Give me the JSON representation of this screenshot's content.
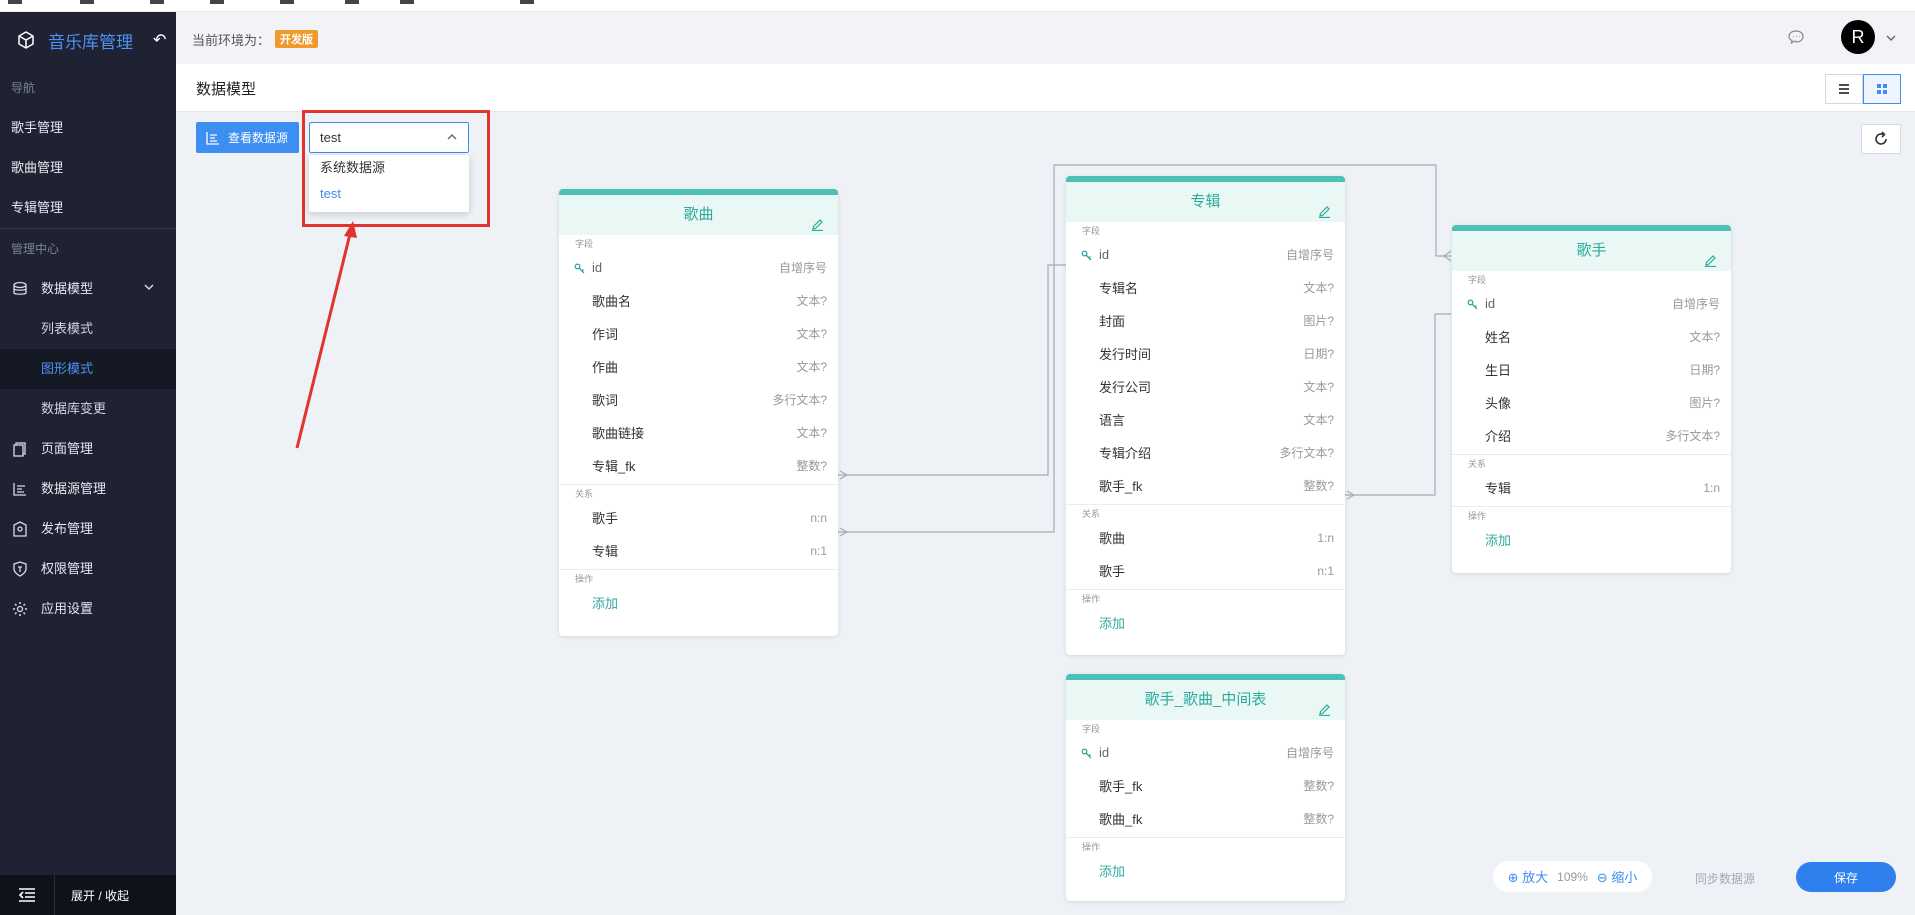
{
  "app": {
    "title": "音乐库管理"
  },
  "sidebar": {
    "section_nav": "导航",
    "nav_items": [
      "歌手管理",
      "歌曲管理",
      "专辑管理"
    ],
    "section_admin": "管理中心",
    "data_model": "数据模型",
    "sub_items": [
      "列表模式",
      "图形模式",
      "数据库变更"
    ],
    "admin_items": [
      {
        "label": "页面管理",
        "icon": "page-icon"
      },
      {
        "label": "数据源管理",
        "icon": "datasource-icon"
      },
      {
        "label": "发布管理",
        "icon": "publish-icon"
      },
      {
        "label": "权限管理",
        "icon": "shield-icon"
      },
      {
        "label": "应用设置",
        "icon": "gear-icon"
      }
    ],
    "toggle_label": "展开 / 收起"
  },
  "header": {
    "env_label": "当前环境为：",
    "env_badge": "开发版",
    "avatar": "R"
  },
  "page": {
    "title": "数据模型"
  },
  "toolbar": {
    "view_datasource": "查看数据源",
    "datasource_value": "test",
    "datasource_options": [
      "系统数据源",
      "test"
    ]
  },
  "tables": [
    {
      "title": "歌曲",
      "fields_label": "字段",
      "fields": [
        {
          "name": "id",
          "type": "自增序号",
          "key": true
        },
        {
          "name": "歌曲名",
          "type": "文本?"
        },
        {
          "name": "作词",
          "type": "文本?"
        },
        {
          "name": "作曲",
          "type": "文本?"
        },
        {
          "name": "歌词",
          "type": "多行文本?"
        },
        {
          "name": "歌曲链接",
          "type": "文本?"
        },
        {
          "name": "专辑_fk",
          "type": "整数?"
        }
      ],
      "relations_label": "关系",
      "relations": [
        {
          "name": "歌手",
          "type": "n:n"
        },
        {
          "name": "专辑",
          "type": "n:1"
        }
      ],
      "actions_label": "操作",
      "add": "添加"
    },
    {
      "title": "专辑",
      "fields_label": "字段",
      "fields": [
        {
          "name": "id",
          "type": "自增序号",
          "key": true
        },
        {
          "name": "专辑名",
          "type": "文本?"
        },
        {
          "name": "封面",
          "type": "图片?"
        },
        {
          "name": "发行时间",
          "type": "日期?"
        },
        {
          "name": "发行公司",
          "type": "文本?"
        },
        {
          "name": "语言",
          "type": "文本?"
        },
        {
          "name": "专辑介绍",
          "type": "多行文本?"
        },
        {
          "name": "歌手_fk",
          "type": "整数?"
        }
      ],
      "relations_label": "关系",
      "relations": [
        {
          "name": "歌曲",
          "type": "1:n"
        },
        {
          "name": "歌手",
          "type": "n:1"
        }
      ],
      "actions_label": "操作",
      "add": "添加"
    },
    {
      "title": "歌手",
      "fields_label": "字段",
      "fields": [
        {
          "name": "id",
          "type": "自增序号",
          "key": true
        },
        {
          "name": "姓名",
          "type": "文本?"
        },
        {
          "name": "生日",
          "type": "日期?"
        },
        {
          "name": "头像",
          "type": "图片?"
        },
        {
          "name": "介绍",
          "type": "多行文本?"
        }
      ],
      "relations_label": "关系",
      "relations": [
        {
          "name": "专辑",
          "type": "1:n"
        }
      ],
      "actions_label": "操作",
      "add": "添加"
    },
    {
      "title": "歌手_歌曲_中间表",
      "fields_label": "字段",
      "fields": [
        {
          "name": "id",
          "type": "自增序号",
          "key": true
        },
        {
          "name": "歌手_fk",
          "type": "整数?"
        },
        {
          "name": "歌曲_fk",
          "type": "整数?"
        }
      ],
      "relations_label": "",
      "relations": [],
      "actions_label": "操作",
      "add": "添加"
    }
  ],
  "bottom": {
    "zoom_in": "放大",
    "zoom_level": "109%",
    "zoom_out": "缩小",
    "sync": "同步数据源",
    "save": "保存"
  },
  "colors": {
    "accent": "#3d8ef1",
    "teal": "#4fc0b5",
    "sidebar": "#1e2232",
    "annotation": "#e2332c"
  }
}
